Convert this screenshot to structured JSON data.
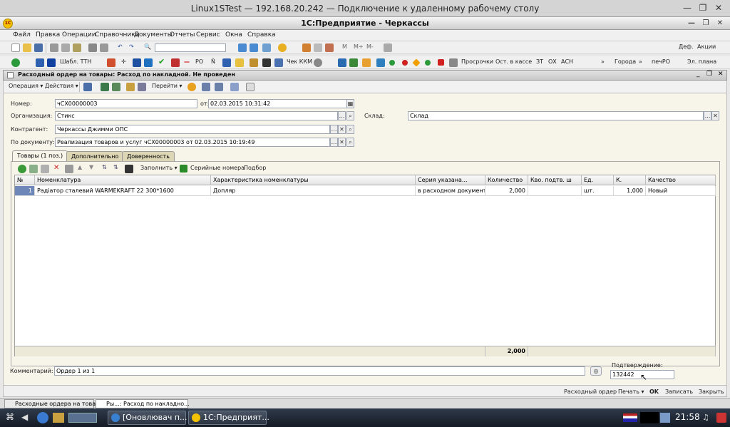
{
  "rdp": {
    "title": "Linux1STest — 192.168.20.242 — Подключение к удаленному рабочему столу",
    "min": "—",
    "restore": "❐",
    "close": "✕"
  },
  "app": {
    "title": "1С:Предприятие - Черкассы",
    "logo_text": "1С"
  },
  "menu": [
    "Файл",
    "Правка",
    "Операции",
    "Справочники",
    "Документы",
    "Отчеты",
    "Сервис",
    "Окна",
    "Справка"
  ],
  "toolbar1": {
    "right_items": [
      "Деф.",
      "Акции"
    ],
    "letters": [
      "M",
      "M+",
      "M-"
    ]
  },
  "toolbar2": {
    "items": [
      "Шабл. ТТН",
      "РО",
      "Чек ККМ",
      "Просрочки",
      "Ост. в кассе",
      "ЗТ",
      "ОХ",
      "АСН",
      "Города",
      "печРО",
      "Эл. плана"
    ]
  },
  "doc": {
    "title": "Расходный ордер на товары: Расход по накладной. Не проведен",
    "toolbar": [
      "Операция",
      "Действия",
      "Перейти"
    ],
    "fields": {
      "number_label": "Номер:",
      "number": "чСХ00000003",
      "date_label": "от:",
      "date": "02.03.2015 10:31:42",
      "org_label": "Организация:",
      "org": "Стикс",
      "warehouse_label": "Склад:",
      "warehouse": "Склад",
      "contractor_label": "Контрагент:",
      "contractor": "Черкассы Джимми ОПС",
      "basedoc_label": "По документу:",
      "basedoc": "Реализация товаров и услуг чСХ00000003 от 02.03.2015 10:19:49"
    },
    "tabs": [
      "Товары (1 поз.)",
      "Дополнительно",
      "Доверенность"
    ],
    "grid_toolbar": {
      "fill": "Заполнить",
      "serials": "Серийные номера",
      "pick": "Подбор"
    },
    "grid": {
      "headers": [
        "№",
        "Номенклатура",
        "Характеристика номенклатуры",
        "Серия указана...",
        "Количество",
        "Кво. подтв. ш",
        "Ед.",
        "К.",
        "Качество"
      ],
      "rows": [
        [
          "1",
          "Радіатор сталевий WARMEKRAFT 22 300*1600",
          "Допляр",
          "в расходном документе",
          "2,000",
          "",
          "шт.",
          "1,000",
          "Новый"
        ]
      ],
      "total_qty": "2,000"
    },
    "comment_label": "Комментарий:",
    "comment": "Ордер 1 из 1",
    "confirm_label": "Подтверждение:",
    "confirm": "132442",
    "actions": [
      "Расходный ордер",
      "Печать",
      "OK",
      "Записать",
      "Закрыть"
    ]
  },
  "window_tabs": [
    "Расходные ордера на това...",
    "Ры...: Расход по накладно..."
  ],
  "taskbar": {
    "items": [
      "[Оновлювач п...",
      "1С:Предприят..."
    ],
    "clock": "21:58"
  }
}
